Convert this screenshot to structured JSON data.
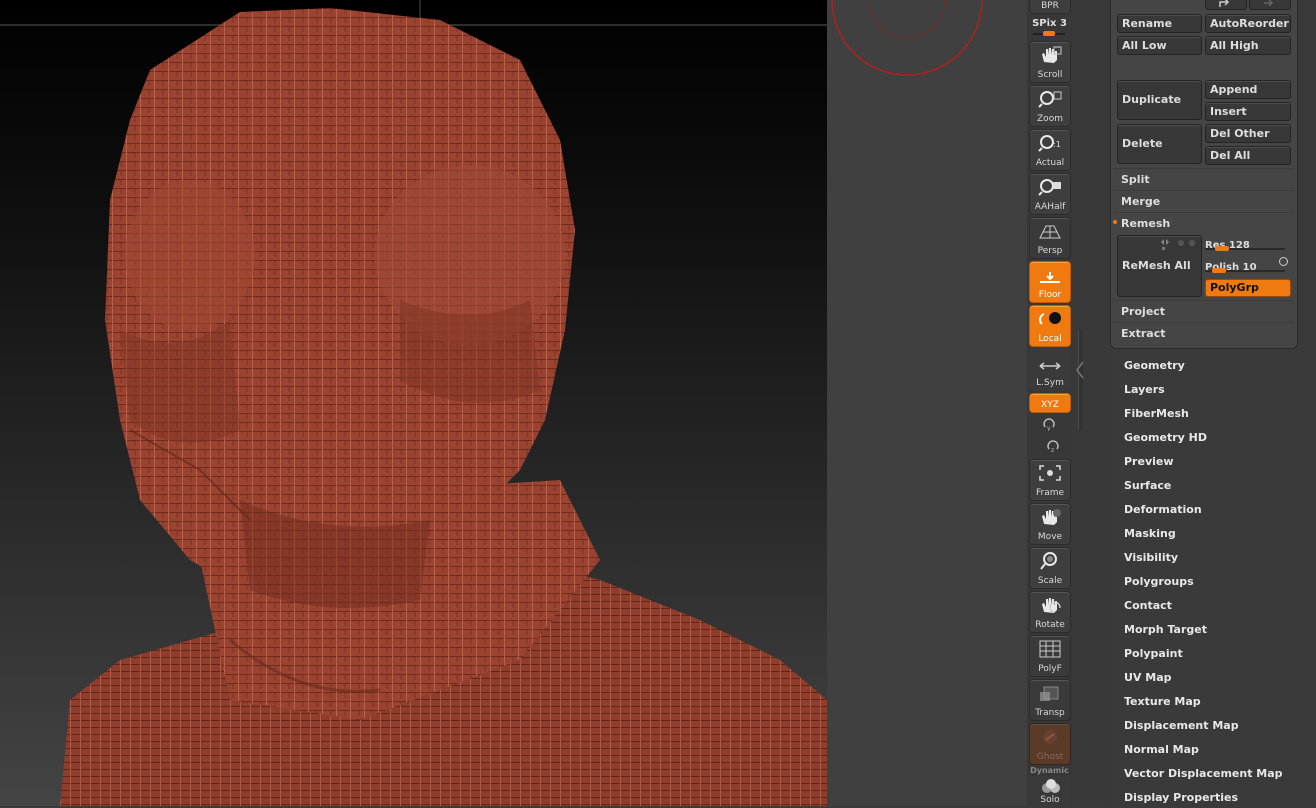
{
  "shelf": {
    "bpr": "BPR",
    "spix": "SPix 3",
    "buttons": [
      {
        "label": "Scroll",
        "icon": "hand-scroll-icon",
        "state": "normal"
      },
      {
        "label": "Zoom",
        "icon": "zoom-magnifier-icon",
        "state": "normal"
      },
      {
        "label": "Actual",
        "icon": "actual-magnifier-icon",
        "state": "normal"
      },
      {
        "label": "AAHalf",
        "icon": "aahalf-magnifier-icon",
        "state": "normal"
      },
      {
        "label": "Persp",
        "icon": "perspective-grid-icon",
        "state": "normal"
      },
      {
        "label": "Floor",
        "icon": "floor-icon",
        "state": "active"
      },
      {
        "label": "Local",
        "icon": "local-pivot-icon",
        "state": "active"
      },
      {
        "label": "L.Sym",
        "icon": "local-symmetry-icon",
        "state": "normal"
      },
      {
        "label": "XYZ",
        "icon": "xyz-rotate-icon",
        "state": "active"
      },
      {
        "label": "Frame",
        "icon": "frame-icon",
        "state": "normal"
      },
      {
        "label": "Move",
        "icon": "hand-move-icon",
        "state": "normal"
      },
      {
        "label": "Scale",
        "icon": "scale-icon",
        "state": "normal"
      },
      {
        "label": "Rotate",
        "icon": "rotate-icon",
        "state": "normal"
      },
      {
        "label": "PolyF",
        "icon": "polyframe-icon",
        "state": "normal"
      },
      {
        "label": "Transp",
        "icon": "transparency-icon",
        "state": "normal"
      },
      {
        "label": "Ghost",
        "icon": "ghost-icon",
        "state": "disabled"
      },
      {
        "label": "Solo",
        "icon": "solo-icon",
        "state": "normal"
      }
    ],
    "dynamic": "Dynamic"
  },
  "subtool": {
    "rename": "Rename",
    "autoreorder": "AutoReorder",
    "all_low": "All Low",
    "all_high": "All High",
    "duplicate": "Duplicate",
    "append": "Append",
    "insert": "Insert",
    "delete": "Delete",
    "del_other": "Del Other",
    "del_all": "Del All",
    "split": "Split",
    "merge": "Merge",
    "remesh": "Remesh",
    "remesh_all": "ReMesh All",
    "res_label": "Res 128",
    "res_value": 0.15,
    "polish_label": "Polish 10",
    "polish_value": 0.1,
    "polygrp": "PolyGrp",
    "project": "Project",
    "extract": "Extract"
  },
  "menu": [
    "Geometry",
    "Layers",
    "FiberMesh",
    "Geometry HD",
    "Preview",
    "Surface",
    "Deformation",
    "Masking",
    "Visibility",
    "Polygroups",
    "Contact",
    "Morph Target",
    "Polypaint",
    "UV Map",
    "Texture Map",
    "Displacement Map",
    "Normal Map",
    "Vector Displacement Map",
    "Display Properties"
  ],
  "colors": {
    "accent": "#f07a10",
    "model": "#9c4430",
    "panel": "#454545"
  }
}
